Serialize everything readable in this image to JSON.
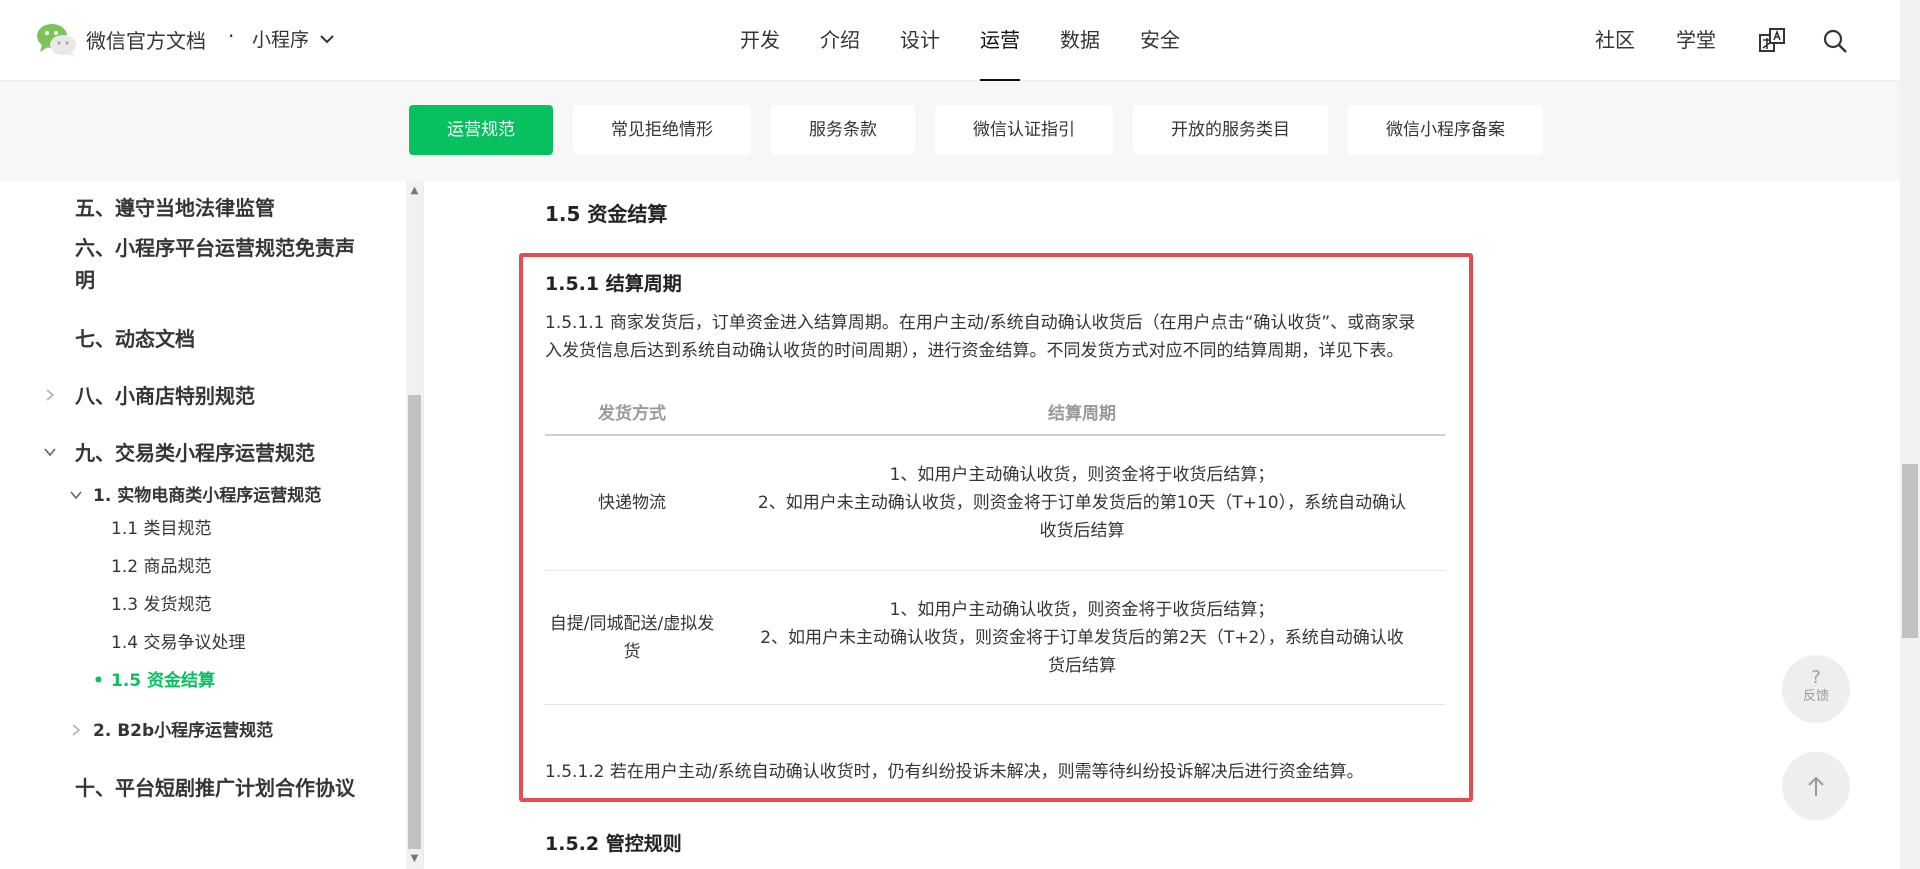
{
  "header": {
    "brand": "微信官方文档",
    "dot": "·",
    "section": "小程序",
    "nav": [
      "开发",
      "介绍",
      "设计",
      "运营",
      "数据",
      "安全"
    ],
    "community": "社区",
    "academy": "学堂"
  },
  "subnav": {
    "tabs": [
      "运营规范",
      "常见拒绝情形",
      "服务条款",
      "微信认证指引",
      "开放的服务类目",
      "微信小程序备案"
    ]
  },
  "sidebar": {
    "items": [
      "五、遵守当地法律监管",
      "六、小程序平台运营规范免责声",
      "明",
      "七、动态文档",
      "八、小商店特别规范",
      "九、交易类小程序运营规范",
      "1. 实物电商类小程序运营规范",
      "1.1 类目规范",
      "1.2 商品规范",
      "1.3 发货规范",
      "1.4 交易争议处理",
      "1.5 资金结算",
      "2. B2b小程序运营规范",
      "十、平台短剧推广计划合作协议"
    ],
    "bullet": "•"
  },
  "content": {
    "section_title": "1.5 资金结算",
    "sub_title": "1.5.1 结算周期",
    "para1_line1": "1.5.1.1 商家发货后，订单资金进入结算周期。在用户主动/系统自动确认收货后（在用户点击“确认收货”、或商家录",
    "para1_line2": "入发货信息后达到系统自动确认收货的时间周期），进行资金结算。不同发货方式对应不同的结算周期，详见下表。",
    "table": {
      "headers": [
        "发货方式",
        "结算周期"
      ],
      "rows": [
        {
          "method": "快递物流",
          "lines": [
            "1、如用户主动确认收货，则资金将于收货后结算；",
            "2、如用户未主动确认收货，则资金将于订单发货后的第10天（T+10），系统自动确认",
            "收货后结算"
          ]
        },
        {
          "method_lines": [
            "自提/同城配送/虚拟发",
            "货"
          ],
          "lines": [
            "1、如用户主动确认收货，则资金将于收货后结算；",
            "2、如用户未主动确认收货，则资金将于订单发货后的第2天（T+2），系统自动确认收",
            "货后结算"
          ]
        }
      ]
    },
    "para2": "1.5.1.2 若在用户主动/系统自动确认收货时，仍有纠纷投诉未解决，则需等待纠纷投诉解决后进行资金结算。",
    "next_title": "1.5.2 管控规则"
  },
  "floating": {
    "feedback_icon": "?",
    "feedback_label": "反馈"
  },
  "colors": {
    "accent": "#07c160",
    "highlight_border": "#e24d4e"
  },
  "icons": [
    "wechat-logo-icon",
    "chevron-down-icon",
    "translate-icon",
    "search-icon",
    "chevron-right-icon",
    "arrow-up-icon"
  ]
}
